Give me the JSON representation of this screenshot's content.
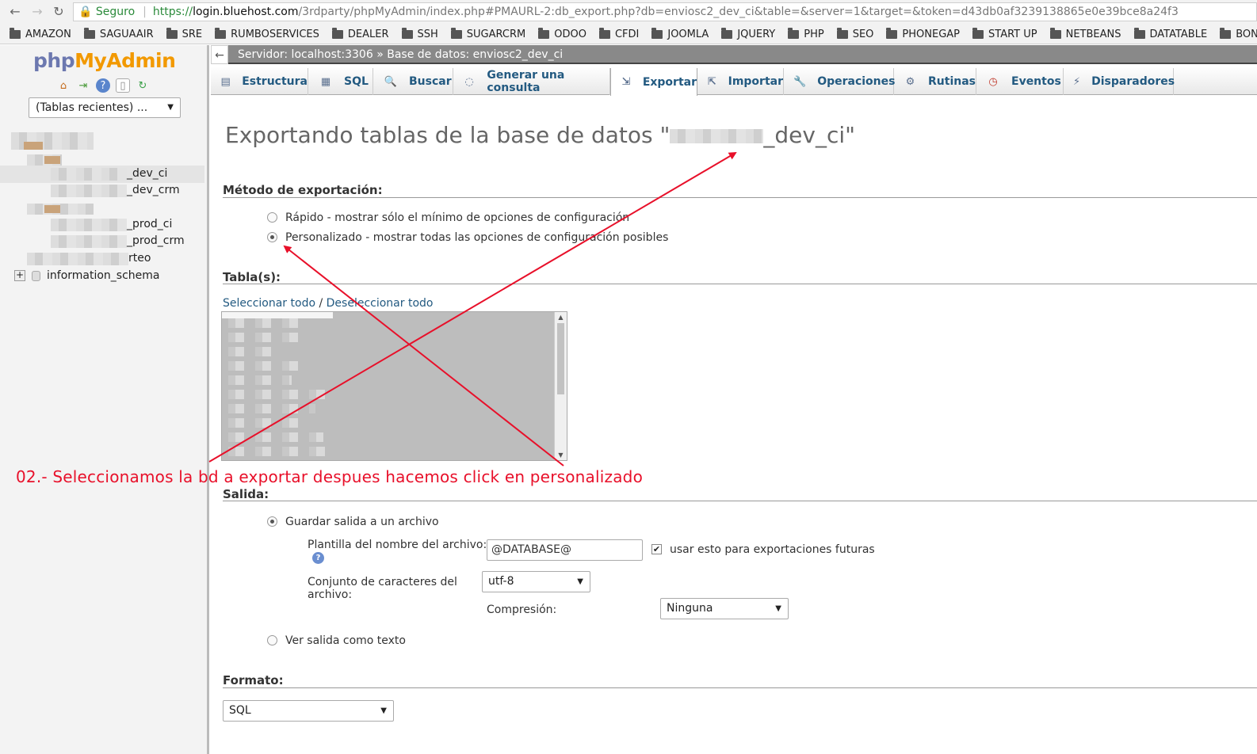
{
  "browser": {
    "security_label": "Seguro",
    "url_scheme": "https://",
    "url_host": "login.bluehost.com",
    "url_path": "/3rdparty/phpMyAdmin/index.php#PMAURL-2:db_export.php?db=enviosc2_dev_ci&table=&server=1&target=&token=d43db0af3239138865e0e39bce8a24f3",
    "bookmarks": [
      "AMAZON",
      "SAGUAAIR",
      "SRE",
      "RUMBOSERVICES",
      "DEALER",
      "SSH",
      "SUGARCRM",
      "ODOO",
      "CFDI",
      "JOOMLA",
      "JQUERY",
      "PHP",
      "SEO",
      "PHONEGAP",
      "START UP",
      "NETBEANS",
      "DATATABLE",
      "BONITA"
    ]
  },
  "sidebar": {
    "logo_php": "php",
    "logo_myadmin": "MyAdmin",
    "recent_tables": "(Tablas recientes) ...",
    "tree": [
      "_dev_ci",
      "_dev_crm",
      "_prod_ci",
      "_prod_crm",
      "rteo",
      "information_schema"
    ]
  },
  "breadcrumb": {
    "back": "←",
    "text": "Servidor: localhost:3306 » Base de datos: enviosc2_dev_ci"
  },
  "tabs": [
    {
      "label": "Estructura",
      "icon": "structure-icon"
    },
    {
      "label": "SQL",
      "icon": "sql-icon"
    },
    {
      "label": "Buscar",
      "icon": "search-icon"
    },
    {
      "label": "Generar una consulta",
      "icon": "query-icon"
    },
    {
      "label": "Exportar",
      "icon": "export-icon"
    },
    {
      "label": "Importar",
      "icon": "import-icon"
    },
    {
      "label": "Operaciones",
      "icon": "wrench-icon"
    },
    {
      "label": "Rutinas",
      "icon": "routines-icon"
    },
    {
      "label": "Eventos",
      "icon": "clock-icon"
    },
    {
      "label": "Disparadores",
      "icon": "triggers-icon"
    }
  ],
  "main": {
    "title_prefix": "Exportando tablas de la base de datos \"",
    "title_suffix": "_dev_ci\"",
    "method_heading": "Método de exportación:",
    "method_quick": "Rápido - mostrar sólo el mínimo de opciones de configuración",
    "method_custom": "Personalizado - mostrar todas las opciones de configuración posibles",
    "tables_heading": "Tabla(s):",
    "select_all": "Seleccionar todo",
    "select_sep": " / ",
    "deselect_all": "Deseleccionar todo",
    "output_heading": "Salida:",
    "save_to_file": "Guardar salida a un archivo",
    "filename_template_label": "Plantilla del nombre del archivo:",
    "filename_template_value": "@DATABASE@",
    "remember_label": "usar esto para exportaciones futuras",
    "charset_label_1": "Conjunto de caracteres del",
    "charset_label_2": "archivo:",
    "charset_value": "utf-8",
    "compression_label": "Compresión:",
    "compression_value": "Ninguna",
    "view_as_text": "Ver salida como texto",
    "format_heading": "Formato:",
    "format_value": "SQL"
  },
  "annotation": {
    "text": "02.- Seleccionamos la bd a exportar despues hacemos click en personalizado",
    "color": "#e8102a"
  }
}
